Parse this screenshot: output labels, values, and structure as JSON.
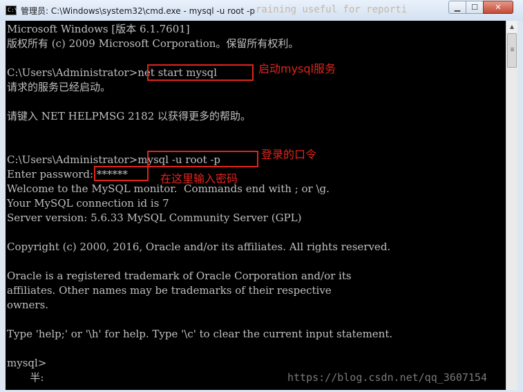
{
  "window": {
    "title": "管理员: C:\\Windows\\system32\\cmd.exe - mysql  -u root -p",
    "icon_text": "C:\\",
    "ghost_text": "raining useful for reporti",
    "controls": {
      "minimize": "▁",
      "maximize": "☐",
      "close": "✕"
    }
  },
  "console": {
    "lines": [
      "Microsoft Windows [版本 6.1.7601]",
      "版权所有 (c) 2009 Microsoft Corporation。保留所有权利。",
      "",
      "C:\\Users\\Administrator>net start mysql",
      "请求的服务已经启动。",
      "",
      "请键入 NET HELPMSG 2182 以获得更多的帮助。",
      "",
      "",
      "C:\\Users\\Administrator>mysql -u root -p",
      "Enter password: ******",
      "Welcome to the MySQL monitor.  Commands end with ; or \\g.",
      "Your MySQL connection id is 7",
      "Server version: 5.6.33 MySQL Community Server (GPL)",
      "",
      "Copyright (c) 2000, 2016, Oracle and/or its affiliates. All rights reserved.",
      "",
      "Oracle is a registered trademark of Oracle Corporation and/or its",
      "affiliates. Other names may be trademarks of their respective",
      "owners.",
      "",
      "Type 'help;' or '\\h' for help. Type '\\c' to clear the current input statement.",
      "",
      "mysql>",
      "       半:"
    ]
  },
  "annotations": {
    "start_service": "启动mysql服务",
    "login_command": "登录的口令",
    "enter_password": "在这里输入密码"
  },
  "watermark": "https://blog.csdn.net/qq_3607154",
  "colors": {
    "console_bg": "#000000",
    "console_text": "#c0c0c0",
    "annotation_red": "#e3241b"
  }
}
